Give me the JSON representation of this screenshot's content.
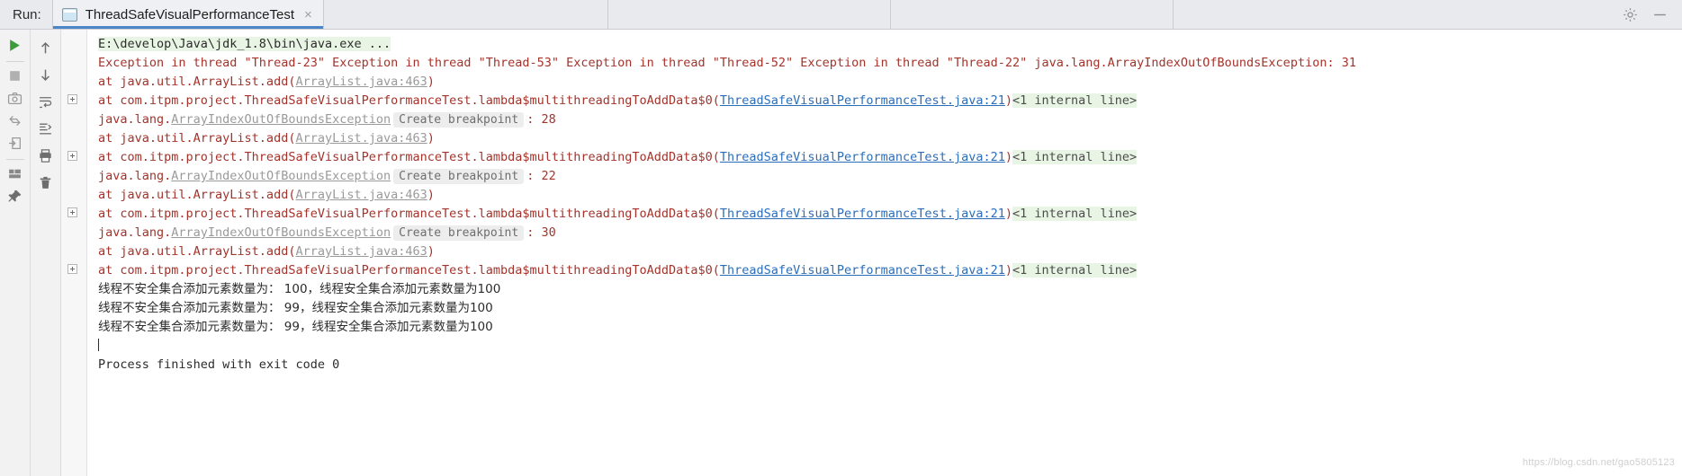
{
  "window": {
    "run_label": "Run:",
    "tab_title": "ThreadSafeVisualPerformanceTest",
    "close_glyph": "×"
  },
  "titlebar_actions": [
    {
      "name": "settings-icon",
      "label": "Settings"
    },
    {
      "name": "hide-icon",
      "label": "Hide"
    }
  ],
  "toolbar_primary": [
    {
      "name": "rerun-button",
      "label": "Rerun"
    },
    {
      "name": "stop-button",
      "label": "Stop"
    },
    {
      "name": "screenshot-button",
      "label": "Screenshot"
    },
    {
      "name": "restore-layout-button",
      "label": "Restore Layout"
    },
    {
      "name": "export-button",
      "label": "Export"
    },
    {
      "name": "layout-settings-button",
      "label": "Layout Settings"
    },
    {
      "name": "pin-tab-button",
      "label": "Pin Tab"
    }
  ],
  "toolbar_secondary": [
    {
      "name": "up-the-stack-trace-button",
      "label": "Up the Stack Trace"
    },
    {
      "name": "down-the-stack-trace-button",
      "label": "Down the Stack Trace"
    },
    {
      "name": "soft-wrap-button",
      "label": "Soft-Wrap"
    },
    {
      "name": "scroll-to-end-button",
      "label": "Scroll to End"
    },
    {
      "name": "print-button",
      "label": "Print"
    },
    {
      "name": "clear-all-button",
      "label": "Clear All"
    }
  ],
  "console": {
    "command": "E:\\develop\\Java\\jdk_1.8\\bin\\java.exe ...",
    "exception_header": "Exception in thread \"Thread-23\" Exception in thread \"Thread-53\" Exception in thread \"Thread-52\" Exception in thread \"Thread-22\" java.lang.ArrayIndexOutOfBoundsException: 31",
    "frame_arraylist_prefix": "    at java.util.ArrayList.add(",
    "frame_arraylist_link": "ArrayList.java:463",
    "frame_arraylist_suffix": ")",
    "frame_lambda_prefix": "    at com.itpm.project.ThreadSafeVisualPerformanceTest.lambda$multithreadingToAddData$0(",
    "frame_lambda_link": "ThreadSafeVisualPerformanceTest.java:21",
    "frame_lambda_suffix": ")",
    "internal_line": "<1 internal line>",
    "exception_package": "java.lang.",
    "exception_class": "ArrayIndexOutOfBoundsException",
    "create_breakpoint": "Create breakpoint",
    "exception_codes": [
      ": 28",
      ": 22",
      ": 30"
    ],
    "results": [
      "线程不安全集合添加元素数量为： 100，线程安全集合添加元素数量为100",
      "线程不安全集合添加元素数量为： 99，线程安全集合添加元素数量为100",
      "线程不安全集合添加元素数量为： 99，线程安全集合添加元素数量为100"
    ],
    "process_finished": "Process finished with exit code 0"
  },
  "watermark": "https://blog.csdn.net/gao5805123",
  "colors": {
    "error_red": "#a4332b",
    "link_blue": "#2a6ebb",
    "link_gray": "#9a9a9a",
    "command_bg": "#e9f5e4",
    "tab_underline": "#4a86c8",
    "run_green": "#3c9c3c"
  }
}
